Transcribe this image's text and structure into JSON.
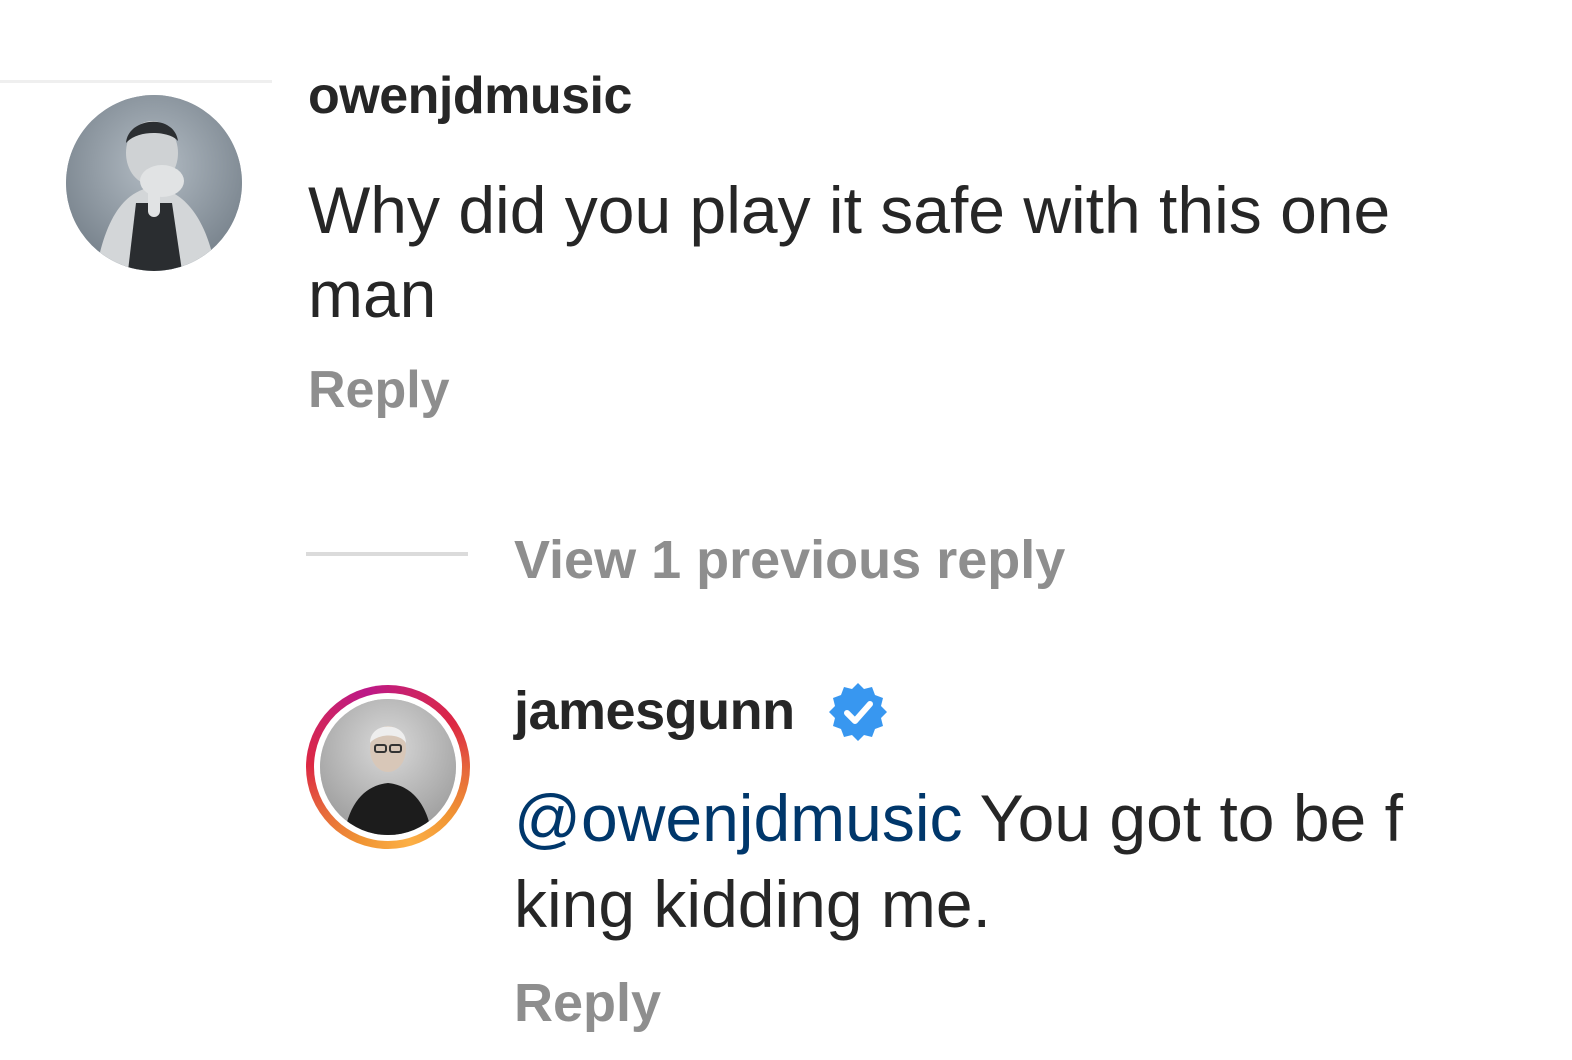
{
  "comment": {
    "username": "owenjdmusic",
    "text": "Why did you play it safe with this one man",
    "reply_label": "Reply",
    "avatar_icon": "user-photo-icon"
  },
  "view_replies": {
    "label": "View 1 previous reply"
  },
  "reply": {
    "username": "jamesgunn",
    "verified": true,
    "verified_icon": "verified-badge-icon",
    "mention": "@owenjdmusic",
    "text_part1": " You got to be f",
    "text_part2": "king kidding me.",
    "reply_label": "Reply",
    "avatar_icon": "user-photo-icon"
  },
  "colors": {
    "text": "#262626",
    "secondary": "#8e8e8e",
    "mention": "#00376b",
    "verified": "#3897f0"
  }
}
